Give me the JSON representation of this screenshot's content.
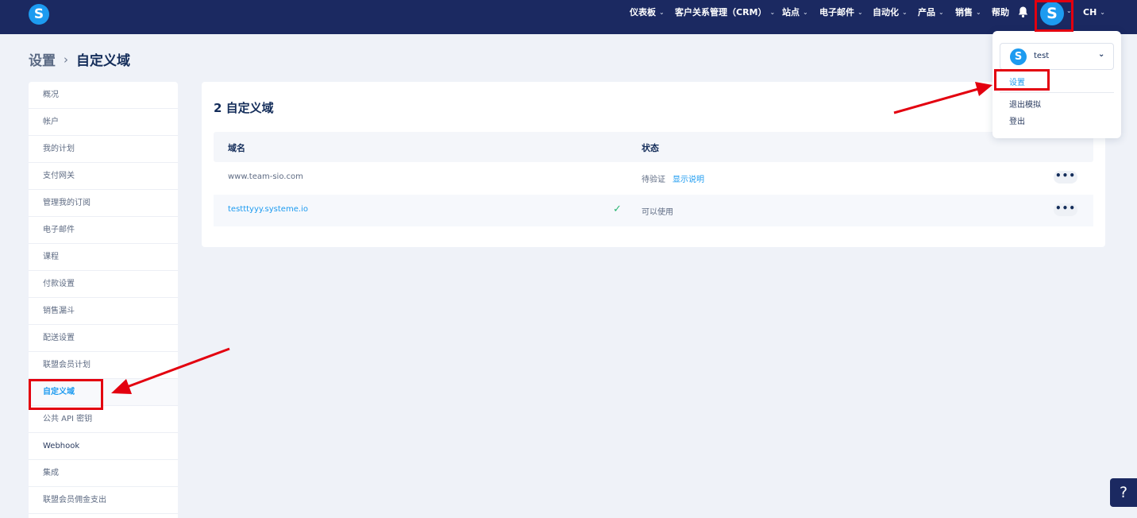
{
  "topbar": {
    "logo": "S",
    "nav": [
      {
        "label": "仪表板"
      },
      {
        "label": "客户关系管理（CRM）"
      },
      {
        "label": "站点"
      },
      {
        "label": "电子邮件"
      },
      {
        "label": "自动化"
      },
      {
        "label": "产品"
      },
      {
        "label": "销售"
      },
      {
        "label": "帮助"
      }
    ],
    "avatar": "S",
    "language": "CH",
    "icons": {
      "bell": "bell-icon",
      "chevron": "chevron-down-icon"
    }
  },
  "breadcrumb": {
    "parent": "设置",
    "separator": "›",
    "current": "自定义域"
  },
  "sidebar": {
    "items": [
      {
        "label": "概况"
      },
      {
        "label": "帐户"
      },
      {
        "label": "我的计划"
      },
      {
        "label": "支付网关"
      },
      {
        "label": "管理我的订阅"
      },
      {
        "label": "电子邮件"
      },
      {
        "label": "课程"
      },
      {
        "label": "付款设置"
      },
      {
        "label": "销售漏斗"
      },
      {
        "label": "配送设置"
      },
      {
        "label": "联盟会员计划"
      },
      {
        "label": "自定义域"
      },
      {
        "label": "公共 API 密钥"
      },
      {
        "label": "Webhook"
      },
      {
        "label": "集成"
      },
      {
        "label": "联盟会员佣金支出"
      }
    ]
  },
  "main": {
    "title": "2 自定义域",
    "columns": [
      "域名",
      "状态"
    ],
    "rows": [
      {
        "domain": "www.team-sio.com",
        "status": "待验证",
        "action_link": "显示说明"
      },
      {
        "domain": "testttyyy.systeme.io",
        "status": "可以使用"
      }
    ],
    "more_label": "•••"
  },
  "dropdown": {
    "account_avatar": "S",
    "account_name": "test",
    "items": [
      "设置",
      "退出模拟",
      "登出"
    ]
  },
  "help": {
    "label": "?"
  },
  "colors": {
    "topbar": "#1b2961",
    "accent": "#1d9bf0",
    "annotation": "#e3000f",
    "success": "#2bb673"
  }
}
